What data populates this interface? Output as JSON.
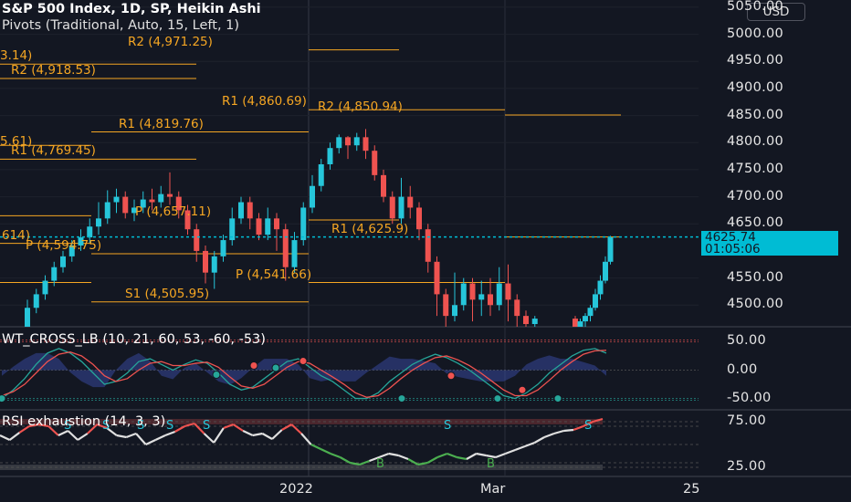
{
  "header": {
    "symbol_line": "S&P 500 Index, 1D, SP, Heikin Ashi",
    "pivots_line": "Pivots (Traditional, Auto, 15, Left, 1)",
    "currency": "USD"
  },
  "price_axis": {
    "ticks": [
      "5050.00",
      "5000.00",
      "4950.00",
      "4900.00",
      "4850.00",
      "4800.00",
      "4750.00",
      "4700.00",
      "4650.00",
      "4550.00",
      "4500.00"
    ],
    "current_price": "4625.74",
    "countdown": "01:05:06"
  },
  "pivot_labels": [
    {
      "text": "R2 (4,971.25)"
    },
    {
      "text": "3.14)"
    },
    {
      "text": "R2 (4,918.53)"
    },
    {
      "text": "R1 (4,860.69)"
    },
    {
      "text": "R2 (4,850.94)"
    },
    {
      "text": "R1 (4,819.76)"
    },
    {
      "text": "5.61)"
    },
    {
      "text": "R1 (4,769.45)"
    },
    {
      "text": "P (4,657.11)"
    },
    {
      "text": "R1 (4,625.9)"
    },
    {
      "text": "614)"
    },
    {
      "text": "P (4,594.75)"
    },
    {
      "text": "P (4,541.66)"
    },
    {
      "text": "S1 (4,505.95)"
    }
  ],
  "wt_panel": {
    "title": "WT_CROSS_LB (10, 21, 60, 53, -60, -53)",
    "ticks": [
      "50.00",
      "0.00",
      "-50.00"
    ]
  },
  "rsi_panel": {
    "title": "RSI exhaustion (14, 3, 3)",
    "ticks": [
      "75.00",
      "25.00"
    ],
    "markers": [
      "S",
      "S",
      "S",
      "S",
      "S",
      "S",
      "B",
      "B",
      "S"
    ]
  },
  "time_axis": {
    "labels": [
      "2022",
      "Mar",
      "25"
    ]
  },
  "colors": {
    "background": "#131722",
    "bull": "#26c6da",
    "bear": "#ef5350",
    "pivot": "#f5a623",
    "price_tag": "#00bcd4"
  },
  "chart_data": {
    "type": "candlestick",
    "style": "Heikin Ashi",
    "symbol": "S&P 500 Index",
    "interval": "1D",
    "ylim": [
      4460,
      5060
    ],
    "current_price": 4625.74,
    "candles": [
      {
        "o": 4460,
        "c": 4495,
        "h": 4510,
        "l": 4455
      },
      {
        "o": 4495,
        "c": 4520,
        "h": 4530,
        "l": 4485
      },
      {
        "o": 4520,
        "c": 4545,
        "h": 4555,
        "l": 4510
      },
      {
        "o": 4545,
        "c": 4570,
        "h": 4580,
        "l": 4535
      },
      {
        "o": 4570,
        "c": 4590,
        "h": 4600,
        "l": 4560
      },
      {
        "o": 4590,
        "c": 4610,
        "h": 4620,
        "l": 4580
      },
      {
        "o": 4610,
        "c": 4625,
        "h": 4640,
        "l": 4600
      },
      {
        "o": 4625,
        "c": 4645,
        "h": 4660,
        "l": 4615
      },
      {
        "o": 4645,
        "c": 4660,
        "h": 4690,
        "l": 4630
      },
      {
        "o": 4660,
        "c": 4690,
        "h": 4712,
        "l": 4650
      },
      {
        "o": 4690,
        "c": 4700,
        "h": 4715,
        "l": 4670
      },
      {
        "o": 4700,
        "c": 4670,
        "h": 4710,
        "l": 4660
      },
      {
        "o": 4670,
        "c": 4680,
        "h": 4695,
        "l": 4655
      },
      {
        "o": 4680,
        "c": 4695,
        "h": 4710,
        "l": 4670
      },
      {
        "o": 4695,
        "c": 4690,
        "h": 4715,
        "l": 4675
      },
      {
        "o": 4690,
        "c": 4705,
        "h": 4720,
        "l": 4680
      },
      {
        "o": 4705,
        "c": 4700,
        "h": 4745,
        "l": 4685
      },
      {
        "o": 4700,
        "c": 4675,
        "h": 4710,
        "l": 4660
      },
      {
        "o": 4675,
        "c": 4640,
        "h": 4685,
        "l": 4630
      },
      {
        "o": 4640,
        "c": 4600,
        "h": 4650,
        "l": 4580
      },
      {
        "o": 4600,
        "c": 4560,
        "h": 4610,
        "l": 4540
      },
      {
        "o": 4560,
        "c": 4590,
        "h": 4600,
        "l": 4530
      },
      {
        "o": 4590,
        "c": 4620,
        "h": 4630,
        "l": 4580
      },
      {
        "o": 4620,
        "c": 4660,
        "h": 4680,
        "l": 4610
      },
      {
        "o": 4660,
        "c": 4690,
        "h": 4700,
        "l": 4650
      },
      {
        "o": 4690,
        "c": 4660,
        "h": 4700,
        "l": 4640
      },
      {
        "o": 4660,
        "c": 4630,
        "h": 4670,
        "l": 4620
      },
      {
        "o": 4630,
        "c": 4660,
        "h": 4680,
        "l": 4620
      },
      {
        "o": 4660,
        "c": 4640,
        "h": 4670,
        "l": 4600
      },
      {
        "o": 4640,
        "c": 4570,
        "h": 4650,
        "l": 4545
      },
      {
        "o": 4570,
        "c": 4620,
        "h": 4635,
        "l": 4560
      },
      {
        "o": 4620,
        "c": 4680,
        "h": 4690,
        "l": 4610
      },
      {
        "o": 4680,
        "c": 4720,
        "h": 4740,
        "l": 4670
      },
      {
        "o": 4720,
        "c": 4760,
        "h": 4770,
        "l": 4710
      },
      {
        "o": 4760,
        "c": 4790,
        "h": 4800,
        "l": 4750
      },
      {
        "o": 4790,
        "c": 4810,
        "h": 4815,
        "l": 4780
      },
      {
        "o": 4810,
        "c": 4795,
        "h": 4812,
        "l": 4770
      },
      {
        "o": 4795,
        "c": 4810,
        "h": 4818,
        "l": 4785
      },
      {
        "o": 4810,
        "c": 4785,
        "h": 4825,
        "l": 4770
      },
      {
        "o": 4785,
        "c": 4740,
        "h": 4795,
        "l": 4730
      },
      {
        "o": 4740,
        "c": 4700,
        "h": 4750,
        "l": 4690
      },
      {
        "o": 4700,
        "c": 4660,
        "h": 4710,
        "l": 4650
      },
      {
        "o": 4660,
        "c": 4700,
        "h": 4735,
        "l": 4650
      },
      {
        "o": 4700,
        "c": 4680,
        "h": 4720,
        "l": 4660
      },
      {
        "o": 4680,
        "c": 4640,
        "h": 4690,
        "l": 4620
      },
      {
        "o": 4640,
        "c": 4580,
        "h": 4650,
        "l": 4560
      },
      {
        "o": 4580,
        "c": 4520,
        "h": 4590,
        "l": 4480
      },
      {
        "o": 4520,
        "c": 4480,
        "h": 4530,
        "l": 4460
      },
      {
        "o": 4480,
        "c": 4500,
        "h": 4560,
        "l": 4470
      },
      {
        "o": 4500,
        "c": 4540,
        "h": 4550,
        "l": 4490
      },
      {
        "o": 4540,
        "c": 4510,
        "h": 4550,
        "l": 4470
      },
      {
        "o": 4510,
        "c": 4520,
        "h": 4545,
        "l": 4480
      },
      {
        "o": 4520,
        "c": 4500,
        "h": 4550,
        "l": 4480
      },
      {
        "o": 4500,
        "c": 4540,
        "h": 4570,
        "l": 4490
      },
      {
        "o": 4540,
        "c": 4510,
        "h": 4575,
        "l": 4470
      },
      {
        "o": 4510,
        "c": 4480,
        "h": 4520,
        "l": 4460
      },
      {
        "o": 4480,
        "c": 4465,
        "h": 4490,
        "l": 4455
      },
      {
        "o": 4465,
        "c": 4475,
        "h": 4480,
        "l": 4455
      },
      {
        "o": 4475,
        "c": 4460,
        "h": 4480,
        "l": 4455
      },
      {
        "o": 4460,
        "c": 4470,
        "h": 4475,
        "l": 4455
      },
      {
        "o": 4470,
        "c": 4480,
        "h": 4485,
        "l": 4460
      },
      {
        "o": 4480,
        "c": 4495,
        "h": 4500,
        "l": 4470
      },
      {
        "o": 4495,
        "c": 4520,
        "h": 4530,
        "l": 4490
      },
      {
        "o": 4520,
        "c": 4545,
        "h": 4555,
        "l": 4510
      },
      {
        "o": 4545,
        "c": 4580,
        "h": 4590,
        "l": 4540
      },
      {
        "o": 4580,
        "c": 4625,
        "h": 4628,
        "l": 4575
      }
    ],
    "pivot_levels": [
      {
        "label": "R2",
        "value": 4971.25
      },
      {
        "label": "R2",
        "value": 4918.53
      },
      {
        "label": "R1",
        "value": 4860.69
      },
      {
        "label": "R2",
        "value": 4850.94
      },
      {
        "label": "R1",
        "value": 4819.76
      },
      {
        "label": "R1",
        "value": 4769.45
      },
      {
        "label": "P",
        "value": 4657.11
      },
      {
        "label": "R1",
        "value": 4625.9
      },
      {
        "label": "P",
        "value": 4594.75
      },
      {
        "label": "P",
        "value": 4541.66
      },
      {
        "label": "S1",
        "value": 4505.95
      }
    ],
    "wt_cross": {
      "ylim": [
        -70,
        70
      ],
      "wt1": [
        -50,
        -35,
        -15,
        10,
        30,
        38,
        30,
        15,
        -5,
        -25,
        -20,
        -5,
        15,
        20,
        10,
        0,
        10,
        18,
        12,
        -5,
        -25,
        -35,
        -30,
        -15,
        0,
        15,
        20,
        5,
        -10,
        -20,
        -35,
        -50,
        -50,
        -40,
        -20,
        -5,
        10,
        20,
        28,
        22,
        12,
        0,
        -15,
        -30,
        -45,
        -50,
        -40,
        -25,
        -5,
        10,
        25,
        35,
        38,
        30
      ],
      "wt2": [
        -45,
        -38,
        -25,
        -5,
        15,
        28,
        32,
        25,
        10,
        -10,
        -20,
        -15,
        0,
        12,
        15,
        8,
        8,
        12,
        14,
        5,
        -12,
        -28,
        -32,
        -25,
        -10,
        5,
        15,
        12,
        0,
        -12,
        -25,
        -40,
        -48,
        -45,
        -32,
        -15,
        0,
        12,
        22,
        25,
        18,
        8,
        -5,
        -20,
        -35,
        -45,
        -45,
        -35,
        -18,
        0,
        15,
        28,
        34,
        35
      ]
    },
    "rsi": {
      "ylim": [
        15,
        85
      ],
      "values": [
        60,
        55,
        63,
        70,
        72,
        70,
        60,
        65,
        55,
        62,
        72,
        68,
        60,
        58,
        62,
        50,
        55,
        60,
        64,
        70,
        73,
        62,
        52,
        68,
        72,
        65,
        60,
        62,
        56,
        66,
        72,
        62,
        50,
        45,
        40,
        36,
        30,
        28,
        32,
        36,
        40,
        38,
        34,
        28,
        30,
        36,
        40,
        36,
        34,
        40,
        38,
        36,
        40,
        44,
        48,
        52,
        58,
        62,
        65,
        66,
        70,
        75,
        78
      ]
    }
  }
}
